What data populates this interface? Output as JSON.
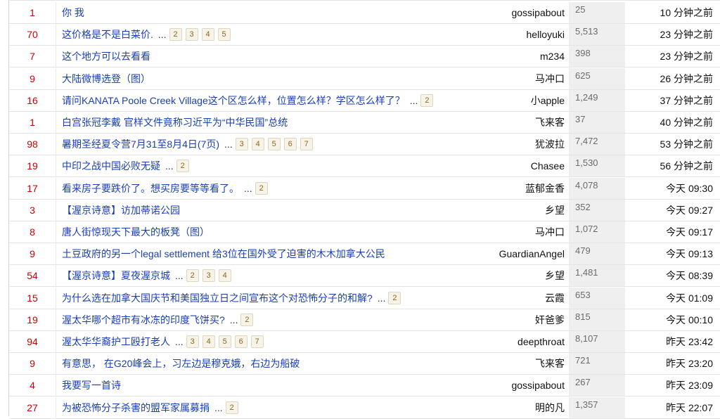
{
  "topics": [
    {
      "replies": "1",
      "title": "你 我",
      "pages": [],
      "author": "gossipabout",
      "views": "25",
      "time": "10 分钟之前"
    },
    {
      "replies": "70",
      "title": "这价格是不是白菜价.",
      "pages": [
        "2",
        "3",
        "4",
        "5"
      ],
      "author": "helloyuki",
      "views": "5,513",
      "time": "23 分钟之前"
    },
    {
      "replies": "7",
      "title": "这个地方可以去看看",
      "pages": [],
      "author": "m234",
      "views": "398",
      "time": "23 分钟之前"
    },
    {
      "replies": "9",
      "title": "大陆微博选登（图）",
      "pages": [],
      "author": "马冲口",
      "views": "625",
      "time": "26 分钟之前"
    },
    {
      "replies": "16",
      "title": "请问KANATA Poole Creek Village这个区怎么样，位置怎么样？学区怎么样了？",
      "pages": [
        "2"
      ],
      "author": "小apple",
      "views": "1,249",
      "time": "37 分钟之前"
    },
    {
      "replies": "1",
      "title": "白宫张冠李戴 官样文件竟称习近平为“中华民国”总统",
      "pages": [],
      "author": "飞来客",
      "views": "37",
      "time": "40 分钟之前"
    },
    {
      "replies": "98",
      "title": "暑期圣经夏令营7月31至8月4日(7页)",
      "pages": [
        "3",
        "4",
        "5",
        "6",
        "7"
      ],
      "author": "犹波拉",
      "views": "7,472",
      "time": "53 分钟之前"
    },
    {
      "replies": "19",
      "title": "中印之战中国必败无疑",
      "pages": [
        "2"
      ],
      "author": "Chasee",
      "views": "1,530",
      "time": "56 分钟之前"
    },
    {
      "replies": "17",
      "title": "看来房子要跌价了。想买房要等等看了。",
      "pages": [
        "2"
      ],
      "author": "蓝郁金香",
      "views": "4,078",
      "time": "今天 09:30"
    },
    {
      "replies": "3",
      "title": "【渥京诗意】访加蒂诺公园",
      "pages": [],
      "author": "乡望",
      "views": "352",
      "time": "今天 09:27"
    },
    {
      "replies": "8",
      "title": "唐人街惊现天下最大的板凳（图）",
      "pages": [],
      "author": "马冲口",
      "views": "1,072",
      "time": "今天 09:17"
    },
    {
      "replies": "9",
      "title": "土豆政府的另一个legal settlement 给3位在国外受了迫害的木木加拿大公民",
      "pages": [],
      "author": "GuardianAngel",
      "views": "479",
      "time": "今天 09:13"
    },
    {
      "replies": "54",
      "title": "【渥京诗意】夏夜渥京城",
      "pages": [
        "2",
        "3",
        "4"
      ],
      "author": "乡望",
      "views": "1,481",
      "time": "今天 08:39"
    },
    {
      "replies": "15",
      "title": "为什么选在加拿大国庆节和美国独立日之间宣布这个对恐怖分子的和解?",
      "pages": [
        "2"
      ],
      "author": "云霞",
      "views": "653",
      "time": "今天 01:09"
    },
    {
      "replies": "19",
      "title": "渥太华哪个超市有冰冻的印度飞饼买?",
      "pages": [
        "2"
      ],
      "author": "奸爸爹",
      "views": "815",
      "time": "今天 00:10"
    },
    {
      "replies": "94",
      "title": "渥太华华裔护工殴打老人",
      "pages": [
        "3",
        "4",
        "5",
        "6",
        "7"
      ],
      "author": "deepthroat",
      "views": "8,107",
      "time": "昨天 23:42"
    },
    {
      "replies": "9",
      "title": "有意思，  在G20峰会上，习左边是穆克娥，右边为船破",
      "pages": [],
      "author": "飞来客",
      "views": "721",
      "time": "昨天 23:20"
    },
    {
      "replies": "4",
      "title": "我要写一首诗",
      "pages": [],
      "author": "gossipabout",
      "views": "267",
      "time": "昨天 23:09"
    },
    {
      "replies": "27",
      "title": "为被恐怖分子杀害的盟军家属募捐",
      "pages": [
        "2"
      ],
      "author": "明的凡",
      "views": "1,357",
      "time": "昨天 22:07"
    }
  ],
  "ellipsis": "..."
}
